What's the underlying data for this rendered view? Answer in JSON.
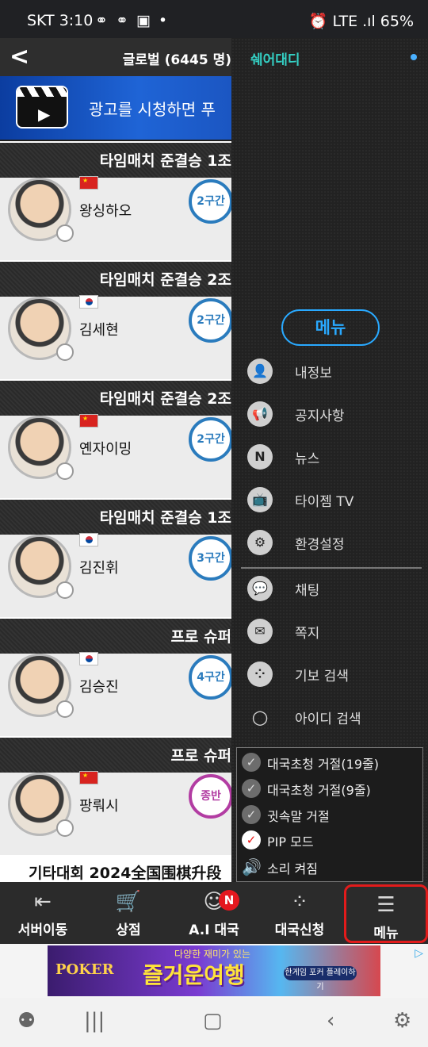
{
  "status_bar": {
    "time": "SKT 3:10",
    "icons": "⚭ ⚭ ▣ •",
    "right": "⏰ LTE .ıl 65%"
  },
  "header": {
    "back_symbol": "<",
    "title": "글로벌 (6445 명)"
  },
  "ad_banner": {
    "text": "광고를 시청하면 푸",
    "icon": "video-clapper-icon"
  },
  "matches": [
    {
      "title": "타임매치 준결승 1조",
      "player": "왕싱하오",
      "country": "cn",
      "badge": "2구간"
    },
    {
      "title": "타임매치 준결승 2조",
      "player": "김세현",
      "country": "kr",
      "badge": "2구간"
    },
    {
      "title": "타임매치 준결승 2조",
      "player": "옌자이밍",
      "country": "cn",
      "badge": "2구간"
    },
    {
      "title": "타임매치 준결승 1조",
      "player": "김진휘",
      "country": "kr",
      "badge": "3구간"
    },
    {
      "title": "프로 슈퍼",
      "player": "김승진",
      "country": "kr",
      "badge": "4구간"
    },
    {
      "title": "프로 슈퍼",
      "player": "팡뤄시",
      "country": "cn",
      "badge": "종반"
    }
  ],
  "last_row": "기타대회  2024全国围棋升段",
  "drawer": {
    "brand": "쉐어대디",
    "menu_button": "메뉴",
    "items": [
      {
        "icon": "person-icon",
        "glyph": "👤",
        "label": "내정보"
      },
      {
        "icon": "megaphone-icon",
        "glyph": "📢",
        "label": "공지사항"
      },
      {
        "icon": "news-icon",
        "glyph": "N",
        "label": "뉴스"
      },
      {
        "icon": "tv-icon",
        "glyph": "📺",
        "label": "타이젬 TV"
      },
      {
        "icon": "gear-icon",
        "glyph": "⚙",
        "label": "환경설정"
      },
      {
        "icon": "chat-icon",
        "glyph": "💬",
        "label": "채팅"
      },
      {
        "icon": "message-icon",
        "glyph": "✉",
        "label": "쪽지"
      },
      {
        "icon": "stones-icon",
        "glyph": "⁘",
        "label": "기보 검색"
      },
      {
        "icon": "search-icon",
        "glyph": "○",
        "label": "아이디 검색"
      }
    ],
    "options": [
      {
        "label": "대국초청 거절(19줄)",
        "checked": false
      },
      {
        "label": "대국초청 거절(9줄)",
        "checked": false
      },
      {
        "label": "귓속말 거절",
        "checked": false
      },
      {
        "label": "PIP 모드",
        "checked": true
      },
      {
        "label": "소리 켜짐",
        "speaker": true
      }
    ]
  },
  "bottom_nav": [
    {
      "icon": "exit-icon",
      "glyph": "⇤",
      "label": "서버이동"
    },
    {
      "icon": "cart-icon",
      "glyph": "🛒",
      "label": "상점"
    },
    {
      "icon": "ai-head-icon",
      "glyph": "☺",
      "label": "A.I 대국",
      "badge": "N"
    },
    {
      "icon": "stones-icon",
      "glyph": "⁘",
      "label": "대국신청"
    },
    {
      "icon": "menu-doc-icon",
      "glyph": "☰",
      "label": "메뉴"
    }
  ],
  "ad_strip": {
    "brand": "POKER",
    "sub": "다양한 재미가 있는",
    "main": "즐거운여행",
    "cta": "한게임 포커 플레이하기"
  }
}
